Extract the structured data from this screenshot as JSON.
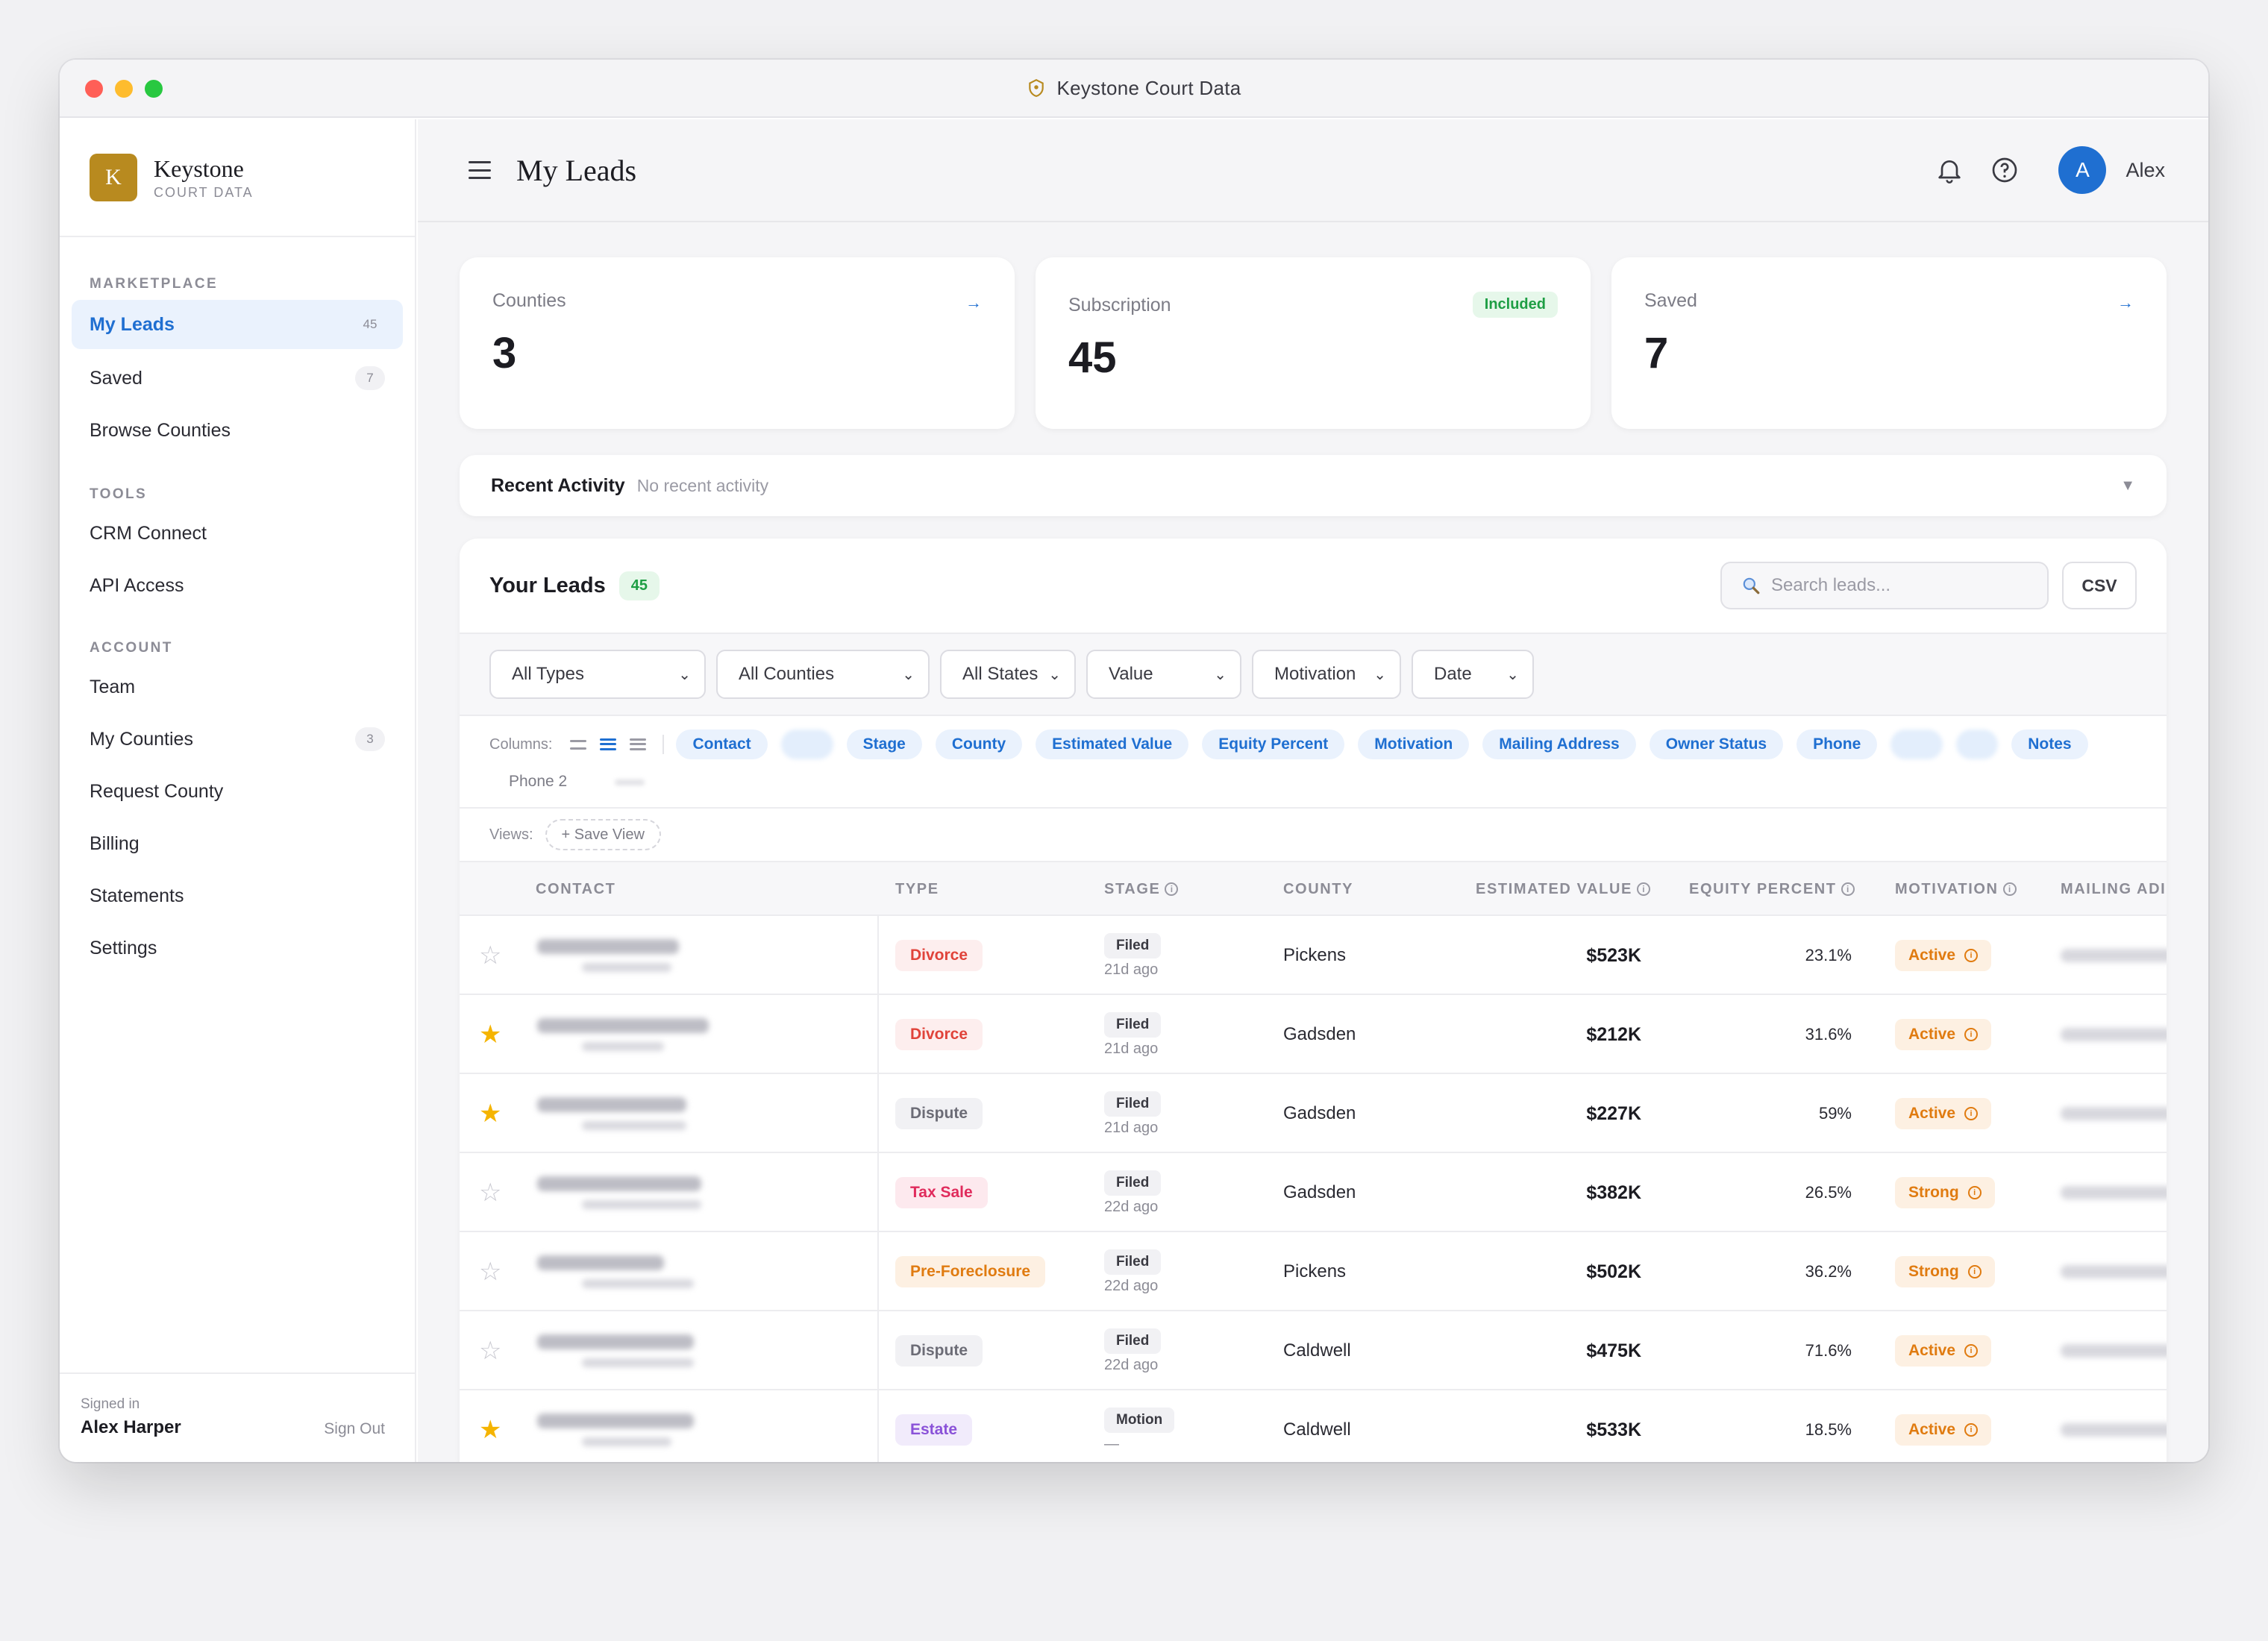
{
  "window": {
    "title": "Keystone Court Data"
  },
  "brand": {
    "logo_letter": "K",
    "name": "Keystone",
    "sub": "COURT DATA"
  },
  "sidebar": {
    "sections": [
      {
        "title": "MARKETPLACE",
        "items": [
          {
            "label": "My Leads",
            "count": "45",
            "active": true
          },
          {
            "label": "Saved",
            "count": "7"
          },
          {
            "label": "Browse Counties"
          }
        ]
      },
      {
        "title": "TOOLS",
        "items": [
          {
            "label": "CRM Connect"
          },
          {
            "label": "API Access"
          }
        ]
      },
      {
        "title": "ACCOUNT",
        "items": [
          {
            "label": "Team"
          },
          {
            "label": "My Counties",
            "count": "3"
          },
          {
            "label": "Request County"
          },
          {
            "label": "Billing"
          },
          {
            "label": "Statements"
          },
          {
            "label": "Settings"
          }
        ]
      }
    ],
    "footer": {
      "signed_in_label": "Signed in",
      "user_name": "Alex Harper",
      "sign_out": "Sign Out"
    }
  },
  "header": {
    "title": "My Leads",
    "user_initial": "A",
    "user_name": "Alex"
  },
  "stats": [
    {
      "label": "Counties",
      "value": "3",
      "arrow": "→"
    },
    {
      "label": "Subscription",
      "value": "45",
      "badge": "Included"
    },
    {
      "label": "Saved",
      "value": "7",
      "arrow": "→"
    }
  ],
  "activity": {
    "title": "Recent Activity",
    "subtitle": "No recent activity",
    "caret": "▼"
  },
  "leads": {
    "title": "Your Leads",
    "count": "45",
    "search_placeholder": "Search leads...",
    "csv_label": "CSV",
    "filters": [
      "All Types",
      "All Counties",
      "All States",
      "Value",
      "Motivation",
      "Date"
    ],
    "columns_label": "Columns:",
    "column_chips": [
      "Contact",
      "",
      "Stage",
      "County",
      "Estimated Value",
      "Equity Percent",
      "Motivation",
      "Mailing Address",
      "Owner Status",
      "Phone",
      "",
      "",
      "Notes"
    ],
    "column_chips_off": [
      "Phone 2",
      ""
    ],
    "views_label": "Views:",
    "save_view": "+ Save View",
    "headers": {
      "contact": "CONTACT",
      "type": "TYPE",
      "stage": "STAGE",
      "county": "COUNTY",
      "estimated_value": "ESTIMATED VALUE",
      "equity_percent": "EQUITY PERCENT",
      "motivation": "MOTIVATION",
      "mailing": "MAILING ADI"
    },
    "rows": [
      {
        "starred": false,
        "type": "Divorce",
        "type_style": "divorce",
        "stage": "Filed",
        "stage_time": "21d ago",
        "county": "Pickens",
        "value": "$523K",
        "equity": "23.1%",
        "motivation": "Active"
      },
      {
        "starred": true,
        "type": "Divorce",
        "type_style": "divorce",
        "stage": "Filed",
        "stage_time": "21d ago",
        "county": "Gadsden",
        "value": "$212K",
        "equity": "31.6%",
        "motivation": "Active"
      },
      {
        "starred": true,
        "type": "Dispute",
        "type_style": "dispute",
        "stage": "Filed",
        "stage_time": "21d ago",
        "county": "Gadsden",
        "value": "$227K",
        "equity": "59%",
        "motivation": "Active"
      },
      {
        "starred": false,
        "type": "Tax Sale",
        "type_style": "taxsale",
        "stage": "Filed",
        "stage_time": "22d ago",
        "county": "Gadsden",
        "value": "$382K",
        "equity": "26.5%",
        "motivation": "Strong"
      },
      {
        "starred": false,
        "type": "Pre-Foreclosure",
        "type_style": "preforeclosure",
        "stage": "Filed",
        "stage_time": "22d ago",
        "county": "Pickens",
        "value": "$502K",
        "equity": "36.2%",
        "motivation": "Strong"
      },
      {
        "starred": false,
        "type": "Dispute",
        "type_style": "dispute",
        "stage": "Filed",
        "stage_time": "22d ago",
        "county": "Caldwell",
        "value": "$475K",
        "equity": "71.6%",
        "motivation": "Active"
      },
      {
        "starred": true,
        "type": "Estate",
        "type_style": "estate",
        "stage": "Motion",
        "stage_time": "—",
        "county": "Caldwell",
        "value": "$533K",
        "equity": "18.5%",
        "motivation": "Active"
      }
    ]
  },
  "colors": {
    "accent": "#1f6fd1",
    "brand": "#b88a1f",
    "star": "#f5b400"
  },
  "icons": [
    "shield-icon",
    "menu-icon",
    "bell-icon",
    "help-icon",
    "search-icon",
    "star-icon",
    "info-icon",
    "chevron-down-icon"
  ]
}
